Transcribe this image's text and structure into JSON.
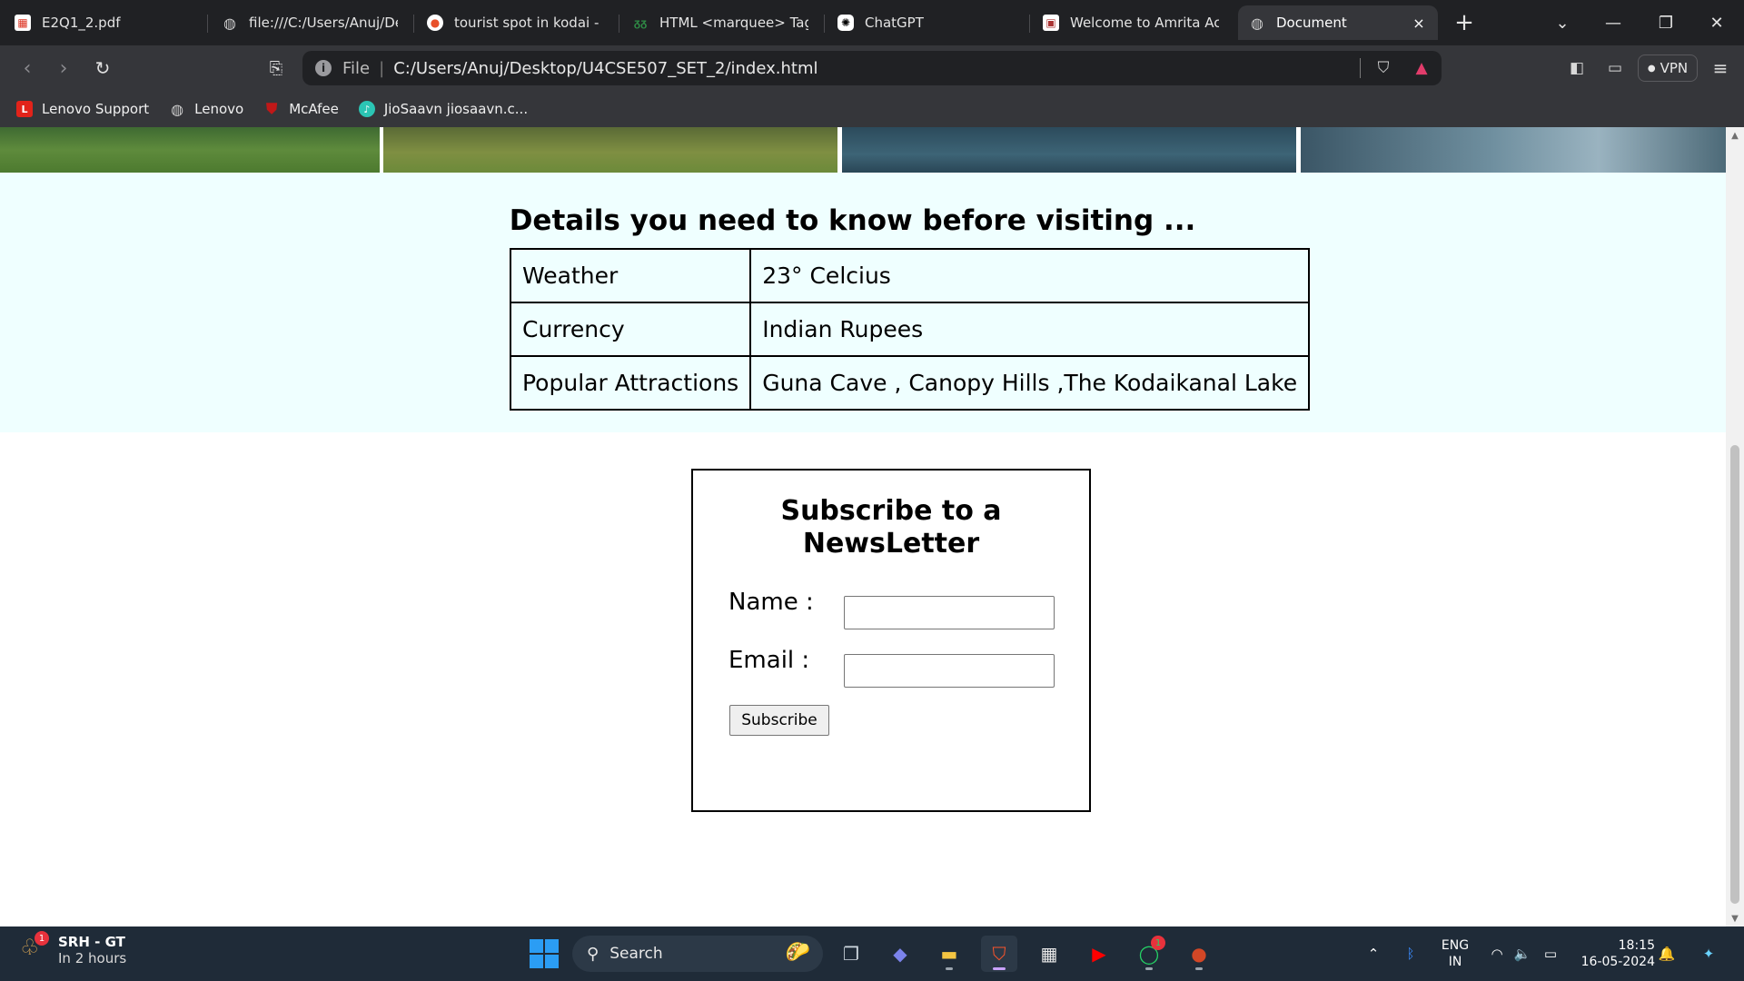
{
  "tabs": [
    {
      "label": "E2Q1_2.pdf",
      "icon": "pdf-file-icon"
    },
    {
      "label": "file:///C:/Users/Anuj/Desk",
      "icon": "globe-icon"
    },
    {
      "label": "tourist spot in kodai - Bra",
      "icon": "brave-search-icon"
    },
    {
      "label": "HTML <marquee> Tag - G",
      "icon": "gfg-icon"
    },
    {
      "label": "ChatGPT",
      "icon": "chatgpt-icon"
    },
    {
      "label": "Welcome to Amrita Acade",
      "icon": "amrita-icon"
    },
    {
      "label": "Document",
      "icon": "globe-icon"
    }
  ],
  "tab_close": "×",
  "new_tab": "+",
  "address": {
    "scheme": "File",
    "url": "C:/Users/Anuj/Desktop/U4CSE507_SET_2/index.html"
  },
  "vpn_label": "VPN",
  "bookmarks": [
    {
      "label": "Lenovo Support",
      "icon_text": "L",
      "color": "#e2231a"
    },
    {
      "label": "Lenovo",
      "icon_text": "",
      "color": "#8a8a8e"
    },
    {
      "label": "McAfee",
      "icon_text": "",
      "color": "#c01818"
    },
    {
      "label": "JioSaavn jiosaavn.c...",
      "icon_text": "",
      "color": "#2bc5b4"
    }
  ],
  "page": {
    "details_heading": "Details you need to know before visiting ...",
    "table": [
      {
        "key": "Weather",
        "value": "23° Celcius"
      },
      {
        "key": "Currency",
        "value": "Indian Rupees"
      },
      {
        "key": "Popular Attractions",
        "value": "Guna Cave , Canopy Hills ,The Kodaikanal Lake"
      }
    ],
    "subscribe": {
      "heading": "Subscribe to a NewsLetter",
      "name_label": "Name :",
      "email_label": "Email :",
      "name_value": "",
      "email_value": "",
      "button": "Subscribe"
    }
  },
  "taskbar": {
    "weather_title": "SRH - GT",
    "weather_sub": "In 2 hours",
    "weather_badge": "1",
    "search_placeholder": "Search",
    "whatsapp_badge": "1",
    "lang_line1": "ENG",
    "lang_line2": "IN",
    "time": "18:15",
    "date": "16-05-2024"
  },
  "colors": {
    "details_bg": "#efffff",
    "chrome_dark": "#202124",
    "chrome_mid": "#35363a",
    "taskbar": "#1f2b38"
  }
}
